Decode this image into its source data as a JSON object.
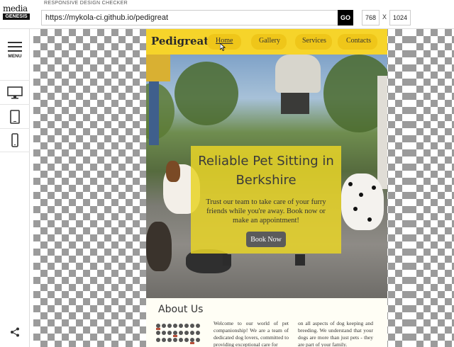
{
  "app": {
    "logo_top": "media",
    "logo_bottom": "GENESIS",
    "title": "RESPONSIVE DESIGN CHECKER",
    "url": "https://mykola-ci.github.io/pedigreat",
    "go_label": "GO",
    "width_value": "768",
    "height_value": "1024",
    "times_label": "X"
  },
  "sidebar": {
    "menu_label": "MENU",
    "devices": [
      "desktop-icon",
      "tablet-icon",
      "mobile-icon"
    ],
    "share_icon": "share-icon"
  },
  "site": {
    "brand": "Pedigreat",
    "nav": [
      {
        "label": "Home",
        "active": true
      },
      {
        "label": "Gallery",
        "active": false
      },
      {
        "label": "Services",
        "active": false
      },
      {
        "label": "Contacts",
        "active": false
      }
    ],
    "hero": {
      "title_line1": "Reliable Pet Sitting in",
      "title_line2": "Berkshire",
      "text": "Trust our team to take care of your furry friends while you're away. Book now or make an appointment!",
      "button": "Book Now"
    },
    "about": {
      "title": "About Us",
      "col1": "Welcome to our world of pet companionship! We are a team of dedicated dog lovers, committed to providing exceptional care for",
      "col2": "on all aspects of dog keeping and breeding. We understand that your dogs are more than just pets - they are part of your family."
    }
  },
  "colors": {
    "accent": "#f6d42a",
    "go_button": "#000000",
    "book_button": "#5b5b5b"
  }
}
